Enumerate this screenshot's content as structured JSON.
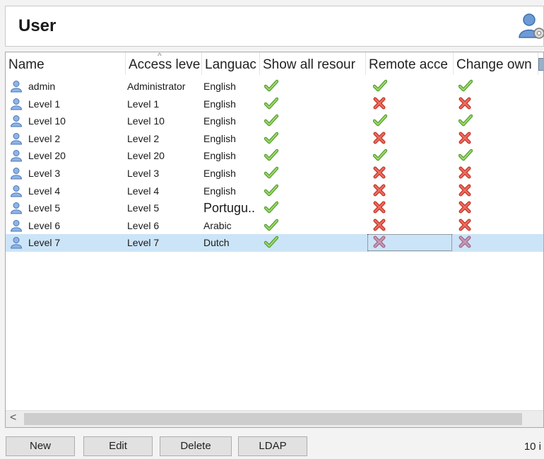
{
  "window": {
    "title": "User",
    "icon": "user-settings-icon"
  },
  "grid": {
    "columns": [
      {
        "label": "Name"
      },
      {
        "label": "Access leve"
      },
      {
        "label": "Languac"
      },
      {
        "label": "Show all resour"
      },
      {
        "label": "Remote acce"
      },
      {
        "label": "Change own"
      }
    ],
    "sort_indicator": "^",
    "rows": [
      {
        "name": "admin",
        "access": "Administrator",
        "language": "English",
        "show_all": "check",
        "remote": "check",
        "change_own": "check"
      },
      {
        "name": "Level 1",
        "access": "Level 1",
        "language": "English",
        "show_all": "check",
        "remote": "cross",
        "change_own": "cross"
      },
      {
        "name": "Level 10",
        "access": "Level 10",
        "language": "English",
        "show_all": "check",
        "remote": "check",
        "change_own": "check"
      },
      {
        "name": "Level 2",
        "access": "Level 2",
        "language": "English",
        "show_all": "check",
        "remote": "cross",
        "change_own": "cross"
      },
      {
        "name": "Level 20",
        "access": "Level 20",
        "language": "English",
        "show_all": "check",
        "remote": "check",
        "change_own": "check"
      },
      {
        "name": "Level 3",
        "access": "Level 3",
        "language": "English",
        "show_all": "check",
        "remote": "cross",
        "change_own": "cross"
      },
      {
        "name": "Level 4",
        "access": "Level 4",
        "language": "English",
        "show_all": "check",
        "remote": "cross",
        "change_own": "cross"
      },
      {
        "name": "Level 5",
        "access": "Level 5",
        "language": "Portugu..",
        "show_all": "check",
        "remote": "cross",
        "change_own": "cross"
      },
      {
        "name": "Level 6",
        "access": "Level 6",
        "language": "Arabic",
        "show_all": "check",
        "remote": "cross",
        "change_own": "cross"
      },
      {
        "name": "Level 7",
        "access": "Level 7",
        "language": "Dutch",
        "show_all": "check",
        "remote": "cross",
        "change_own": "cross",
        "selected": true
      }
    ]
  },
  "scrollbar": {
    "left_arrow": "<"
  },
  "footer": {
    "buttons": [
      {
        "label": "New"
      },
      {
        "label": "Edit"
      },
      {
        "label": "Delete"
      },
      {
        "label": "LDAP"
      }
    ],
    "count": "10 i"
  },
  "colors": {
    "check": "#7cc242",
    "cross": "#d9534f",
    "selected_row": "#cce4f7",
    "user_icon": "#5b8fd0"
  }
}
